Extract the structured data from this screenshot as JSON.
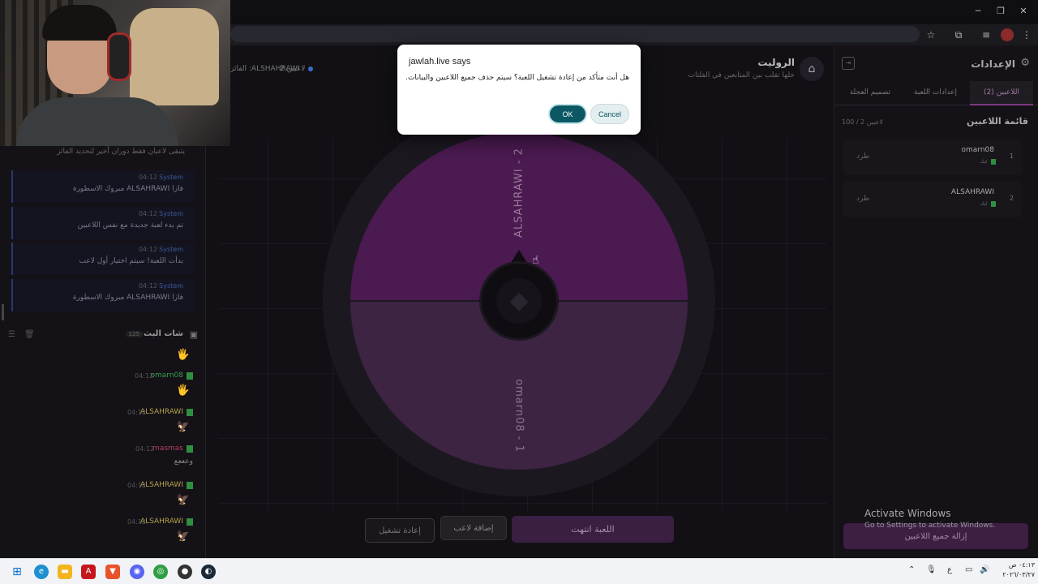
{
  "browser": {
    "window_controls": {
      "minimize": "─",
      "maximize": "❐",
      "close": "✕"
    }
  },
  "dialog": {
    "title": "jawlah.live says",
    "message": "هل أنت متأكد من إعادة تشغيل اللعبة؟ سيتم حذف جميع اللاعبين والبيانات.",
    "ok_label": "OK",
    "cancel_label": "Cancel",
    "ok_color": "#0b5764"
  },
  "wheel_header": {
    "title": "الروليت",
    "subtitle": "خلها تقلب بين المتابعين في الفلتات",
    "winner_label": "الفائز :ALSHAHRAWI",
    "player_count": "2 لاعبين"
  },
  "wheel": {
    "segments": [
      {
        "label": "ALSAHRAWI - 2",
        "color": "#4a1a50"
      },
      {
        "label": "omarn08 - 1",
        "color": "#3c2442"
      }
    ]
  },
  "controls": {
    "game_over": "اللعبة انتهت",
    "add_player": "إضافة لاعب",
    "restart": "إعادة تشغيل"
  },
  "chat": {
    "top_line": "يتبقى لاعبان فقط دوران أخير لتحديد الفائز",
    "system_messages": [
      {
        "name": "System",
        "time": "04:12",
        "text": "مبروك الاسطورة ALSAHRAWI فازا"
      },
      {
        "name": "System",
        "time": "04:12",
        "text": "تم بدء لعبة جديدة مع نفس اللاعبين"
      },
      {
        "name": "System",
        "time": "04:12",
        "text": "بدأت اللعبة! سيتم اختيار أول لاعب"
      },
      {
        "name": "System",
        "time": "04:12",
        "text": "مبروك الاسطورة ALSAHRAWI فازا"
      }
    ],
    "live_chat_title": "شات البث",
    "live_chat_badge": "125",
    "messages": [
      {
        "name": "",
        "time": "",
        "text": "🖐"
      },
      {
        "name": "omarn08",
        "time": "04:12",
        "text": "🖐"
      },
      {
        "name": "ALSAHRAWI",
        "time": "04:12",
        "text": "🦅"
      },
      {
        "name": "masmas",
        "time": "04:12",
        "text": "وعععع"
      },
      {
        "name": "ALSAHRAWI",
        "time": "04:12",
        "text": "🦅"
      },
      {
        "name": "ALSAHRAWI",
        "time": "04:12",
        "text": "🦅"
      }
    ]
  },
  "settings": {
    "title": "الإعدادات",
    "tabs": [
      "اللاعبين (2)",
      "إعدادات اللعبة",
      "تصميم العجلة"
    ],
    "players_list_title": "قائمة اللاعبين",
    "players_counter": "100 / 2 لاعبين",
    "players": [
      {
        "index": "1",
        "name": "omarn08",
        "platform": "كيك",
        "kick_label": "طرد"
      },
      {
        "index": "2",
        "name": "ALSAHRAWI",
        "platform": "كيك",
        "kick_label": "طرد"
      }
    ],
    "remove_all": "إزالة جميع اللاعبين"
  },
  "watermark": {
    "title": "Activate Windows",
    "subtitle": "Go to Settings to activate Windows."
  },
  "taskbar": {
    "clock_time": "٠٤:١٣ ص",
    "clock_date": "٢٠٢٦/٠٣/٢٧",
    "lang": "ع"
  }
}
